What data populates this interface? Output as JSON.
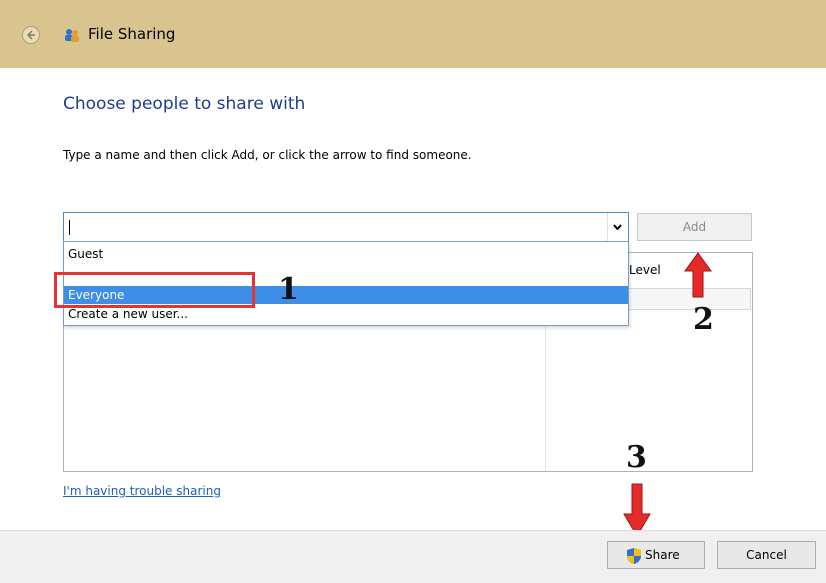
{
  "window": {
    "title": "File Sharing",
    "back_icon": "back-arrow-icon",
    "app_icon": "people-sharing-icon",
    "titlebar_color": "#d9c48f"
  },
  "main": {
    "heading": "Choose people to share with",
    "instruction": "Type a name and then click Add, or click the arrow to find someone.",
    "name_input": {
      "value": ""
    },
    "add_label": "Add",
    "table": {
      "permission_header": "Level"
    },
    "dropdown_options": [
      "Guest",
      "Everyone",
      "Create a new user..."
    ],
    "selected_option": "Everyone",
    "trouble_link": "I'm having trouble sharing"
  },
  "annotations": {
    "step1": "1",
    "step2": "2",
    "step3": "3",
    "highlight_color": "#e53333"
  },
  "footer": {
    "share_label": "Share",
    "cancel_label": "Cancel",
    "shield_icon": "uac-shield-icon"
  }
}
